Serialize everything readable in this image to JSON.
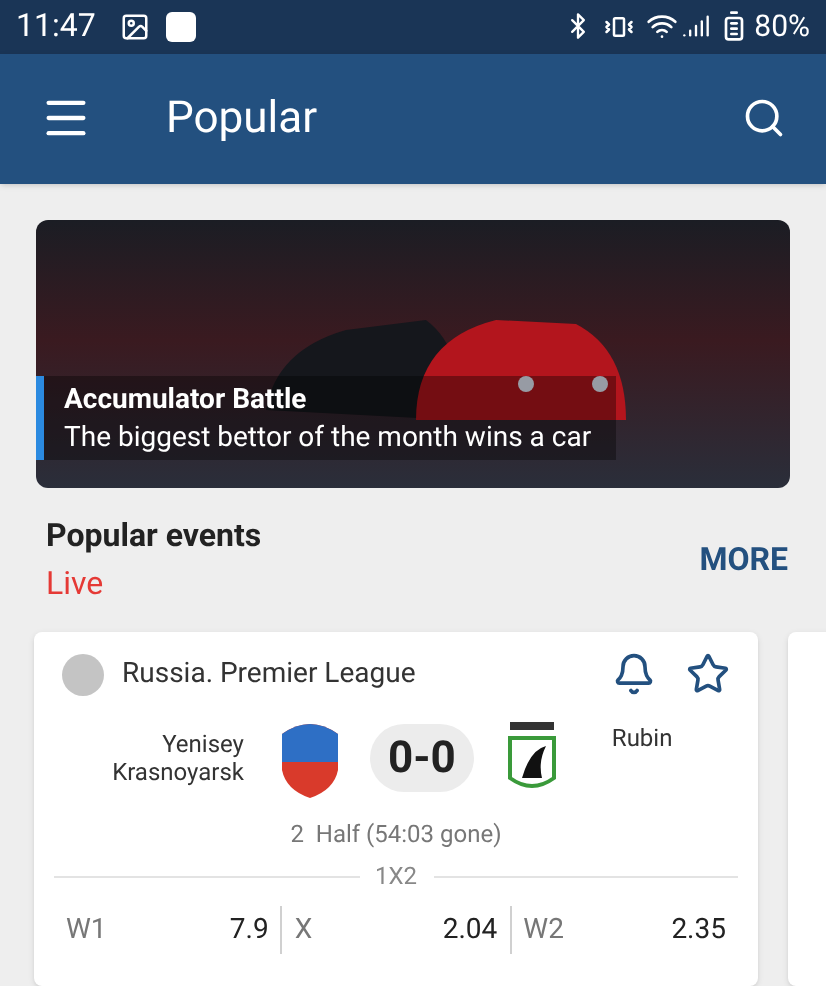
{
  "status_bar": {
    "time": "11:47",
    "battery": "80%"
  },
  "app_bar": {
    "title": "Popular"
  },
  "banner": {
    "title": "Accumulator Battle",
    "subtitle": "The biggest bettor of the month wins a car"
  },
  "section": {
    "title": "Popular events",
    "subtitle": "Live",
    "action": "MORE"
  },
  "events": [
    {
      "league": "Russia. Premier League",
      "notify": false,
      "favorite": false,
      "team1": "Yenisey Krasnoyarsk",
      "team2": "Rubin",
      "score": "0-0",
      "period": "2  Half (54:03 gone)",
      "market": "1X2",
      "odds": [
        {
          "label": "W1",
          "value": "7.9"
        },
        {
          "label": "X",
          "value": "2.04"
        },
        {
          "label": "W2",
          "value": "2.35"
        }
      ]
    }
  ]
}
